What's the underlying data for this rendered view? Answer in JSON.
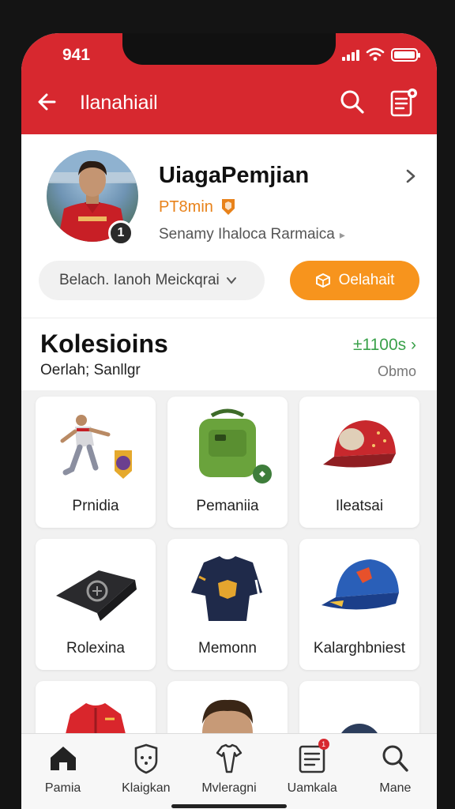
{
  "status_bar": {
    "time": "941"
  },
  "header": {
    "title": "Ilanahiail"
  },
  "profile": {
    "name": "UiagaPemjian",
    "subtitle": "PT8min",
    "description": "Senamy Ihaloca Rarmaica",
    "avatar_badge": "1",
    "filter_label": "Belach. Ianoh Meickqrai",
    "action_label": "Oelahait"
  },
  "section": {
    "title": "Kolesioins",
    "link": "±1100s",
    "subtitle": "Oerlah; Sanllgr",
    "count": "Obmo"
  },
  "items": [
    {
      "label": "Prnidia",
      "icon": "player-kick"
    },
    {
      "label": "Pemaniia",
      "icon": "backpack"
    },
    {
      "label": "Ileatsai",
      "icon": "cap-red"
    },
    {
      "label": "Rolexina",
      "icon": "scarf-black"
    },
    {
      "label": "Memonn",
      "icon": "shirt-navy"
    },
    {
      "label": "Kalarghbniest",
      "icon": "cap-blue"
    },
    {
      "label": "",
      "icon": "jacket-red"
    },
    {
      "label": "",
      "icon": "portrait"
    },
    {
      "label": "",
      "icon": "ball"
    }
  ],
  "tabbar": [
    {
      "label": "Pamia",
      "icon": "home-icon"
    },
    {
      "label": "Klaigkan",
      "icon": "shield-icon"
    },
    {
      "label": "Mvleragni",
      "icon": "shirt-outline-icon"
    },
    {
      "label": "Uamkala",
      "icon": "list-icon",
      "badge": "1"
    },
    {
      "label": "Mane",
      "icon": "search-icon"
    }
  ],
  "colors": {
    "brand_red": "#d7282f",
    "accent_orange": "#f7941d",
    "link_green": "#3aa14a"
  }
}
